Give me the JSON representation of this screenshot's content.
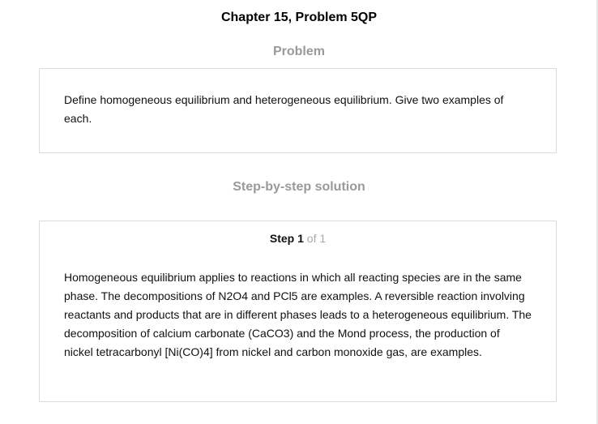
{
  "page": {
    "title": "Chapter 15, Problem 5QP"
  },
  "problem": {
    "heading": "Problem",
    "text": "Define homogeneous equilibrium and heterogeneous equilibrium. Give two examples of each."
  },
  "solution": {
    "heading": "Step-by-step solution",
    "step": {
      "word": "Step",
      "number": "1",
      "of_total": "of 1"
    },
    "text": "Homogeneous equilibrium applies to reactions in which all reacting species are in the same phase. The decompositions of N2O4 and PCl5 are examples. A reversible reaction involving reactants and products that are in different phases leads to a heterogeneous equilibrium. The decomposition of calcium carbonate (CaCO3) and the Mond process, the production of nickel tetracarbonyl [Ni(CO)4] from nickel and carbon monoxide gas, are examples."
  },
  "colors": {
    "heading_gray": "#9a9a9a",
    "border": "#dcdcdc",
    "text": "#111111"
  }
}
